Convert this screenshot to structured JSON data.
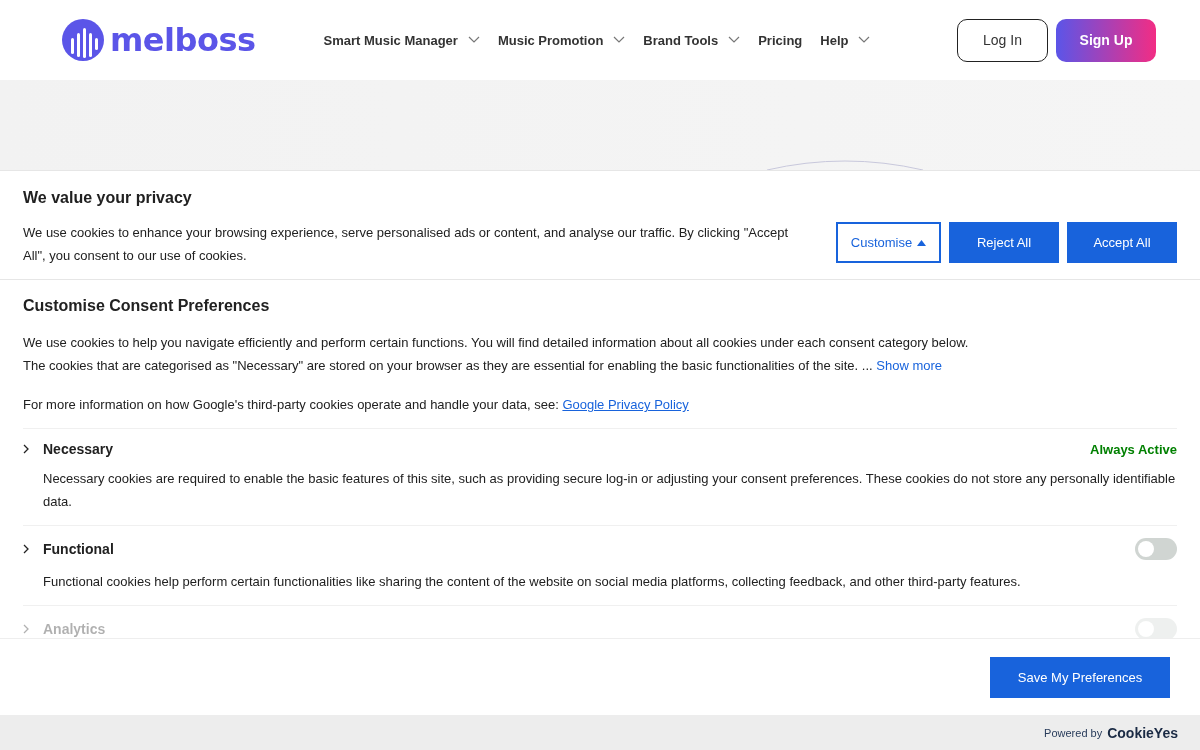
{
  "header": {
    "logo": "melboss",
    "nav": [
      {
        "label": "Smart Music Manager",
        "dropdown": true
      },
      {
        "label": "Music Promotion",
        "dropdown": true
      },
      {
        "label": "Brand Tools",
        "dropdown": true
      },
      {
        "label": "Pricing",
        "dropdown": false
      },
      {
        "label": "Help",
        "dropdown": true
      }
    ],
    "login": "Log In",
    "signup": "Sign Up"
  },
  "banner": {
    "title": "We value your privacy",
    "text": "We use cookies to enhance your browsing experience, serve personalised ads or content, and analyse our traffic. By clicking \"Accept All\", you consent to our use of cookies.",
    "customise": "Customise",
    "expanded": true,
    "reject": "Reject All",
    "accept": "Accept All"
  },
  "preferences": {
    "title": "Customise Consent Preferences",
    "intro_1": "We use cookies to help you navigate efficiently and perform certain functions. You will find detailed information about all cookies under each consent category below.",
    "intro_2": "The cookies that are categorised as \"Necessary\" are stored on your browser as they are essential for enabling the basic functionalities of the site. ...",
    "show_more": "Show more",
    "google_text": "For more information on how Google's third-party cookies operate and handle your data, see:",
    "google_link": "Google Privacy Policy",
    "categories": [
      {
        "name": "Necessary",
        "kind": "always",
        "status": "Always Active",
        "description": "Necessary cookies are required to enable the basic features of this site, such as providing secure log-in or adjusting your consent preferences. These cookies do not store any personally identifiable data."
      },
      {
        "name": "Functional",
        "kind": "toggle",
        "on": false,
        "description": "Functional cookies help perform certain functionalities like sharing the content of the website on social media platforms, collecting feedback, and other third-party features."
      },
      {
        "name": "Analytics",
        "kind": "toggle",
        "on": false,
        "faded": true
      }
    ],
    "save": "Save My Preferences"
  },
  "footer": {
    "powered_by": "Powered by",
    "brand": "CookieYes"
  }
}
